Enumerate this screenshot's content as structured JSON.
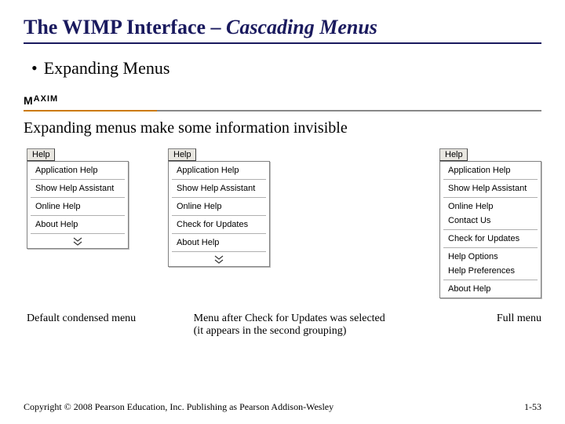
{
  "title_plain": "The WIMP Interface – ",
  "title_italic": "Cascading Menus",
  "bullet1": "Expanding Menus",
  "maxim_label_left": "M",
  "maxim_label_right": "AXIM",
  "maxim_text": "Expanding menus make some information invisible",
  "help_button": "Help",
  "menu1": {
    "items": [
      "Application Help",
      "Show Help Assistant",
      "Online Help",
      "About Help"
    ]
  },
  "menu2": {
    "items": [
      "Application Help",
      "Show Help Assistant",
      "Online Help",
      "Check for Updates",
      "About Help"
    ]
  },
  "menu3": {
    "items": [
      "Application Help",
      "Show Help Assistant",
      "Online Help",
      "Contact Us",
      "Check for Updates",
      "Help Options",
      "Help Preferences",
      "About Help"
    ]
  },
  "caption1": "Default condensed menu",
  "caption2_line1": "Menu after Check for Updates was selected",
  "caption2_line2": "(it appears in the second grouping)",
  "caption3": "Full menu",
  "copyright": "Copyright © 2008 Pearson Education, Inc. Publishing as Pearson Addison-Wesley",
  "page_num": "1-53"
}
